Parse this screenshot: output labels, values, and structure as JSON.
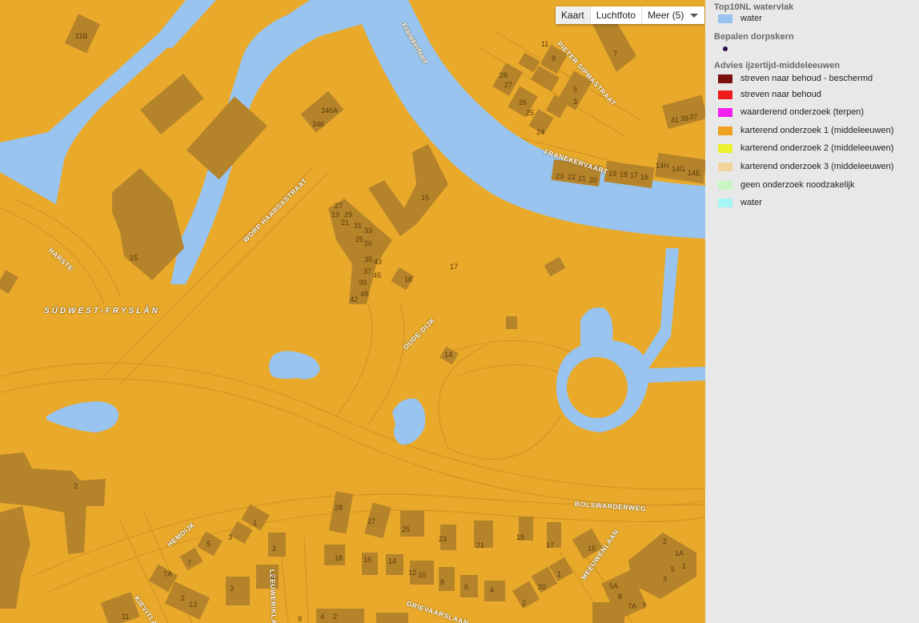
{
  "map_type": {
    "kaart": "Kaart",
    "luchtfoto": "Luchtfoto",
    "meer": "Meer (5)"
  },
  "region_label": "SÚDWEST-FRYSLÂN",
  "streets": {
    "franekervaart_canal": "Franekerfeart",
    "pieter_sipmastraat": "PIETER SIPMASTRAAT",
    "franekervaart": "FRANEKERVAART",
    "worp_haarsastraat": "WORP HAARSASTRAAT",
    "harste": "HARSTE",
    "oude_dijk": "OUDE-DIJK",
    "bolswarderweg": "BOLSWARDERWEG",
    "hemdijk": "HEMDIJK",
    "leeuwerikslaan": "LEEUWERIKLAAN",
    "kievitlaan": "KIEVITLAAN",
    "grieslaan": "GRIEVAARSLAAN",
    "meeuwenlaan": "MEEUWENLAAN"
  },
  "house_numbers": [
    "11B",
    "346A",
    "346",
    "11",
    "9",
    "7",
    "5",
    "3",
    "28",
    "27",
    "26",
    "25",
    "24",
    "41",
    "39",
    "37",
    "14H",
    "14G",
    "14E",
    "23",
    "22",
    "21",
    "20",
    "19",
    "18",
    "17",
    "16",
    "15",
    "27",
    "19",
    "29",
    "21",
    "31",
    "33",
    "25",
    "26",
    "35",
    "43",
    "37",
    "45",
    "39",
    "48",
    "42",
    "18",
    "17",
    "14",
    "15",
    "2",
    "28",
    "27",
    "25",
    "23",
    "21",
    "19",
    "17",
    "15",
    "1",
    "5",
    "3",
    "2",
    "7",
    "7A",
    "4",
    "18",
    "16",
    "14",
    "12",
    "10",
    "8",
    "6",
    "4",
    "2",
    "20",
    "1",
    "3",
    "2",
    "13",
    "11",
    "2",
    "1A",
    "1",
    "3",
    "5",
    "5A",
    "8",
    "7A",
    "7",
    "9",
    "4",
    "2"
  ],
  "legend": {
    "sections": [
      {
        "title": "Top10NL watervlak",
        "items": [
          {
            "label": "water",
            "color": "#98c4ef"
          }
        ]
      },
      {
        "title": "Bepalen dorpskern",
        "items": [
          {
            "label": "",
            "color": "#2b0a4a",
            "shape": "dot"
          }
        ]
      },
      {
        "title": "Advies ijzertijd-middeleeuwen",
        "items": [
          {
            "label": "streven naar behoud - beschermd",
            "color": "#7a0f0f"
          },
          {
            "label": "streven naar behoud",
            "color": "#ee1c1c"
          },
          {
            "label": "waarderend onderzoek (terpen)",
            "color": "#f51ef0"
          },
          {
            "label": "karterend onderzoek 1 (middeleeuwen)",
            "color": "#f0a11f"
          },
          {
            "label": "karterend onderzoek 2 (middeleeuwen)",
            "color": "#ecf22b"
          },
          {
            "label": "karterend onderzoek 3 (middeleeuwen)",
            "color": "#f1d49b"
          },
          {
            "label": "geen onderzoek noodzakelijk",
            "color": "#c9f5c5"
          },
          {
            "label": "water",
            "color": "#a6f5f5"
          }
        ]
      }
    ]
  },
  "colors": {
    "land": "#e9a92a",
    "water": "#98c4ef",
    "building": "#b5832a",
    "road_line": "#d5962a"
  }
}
